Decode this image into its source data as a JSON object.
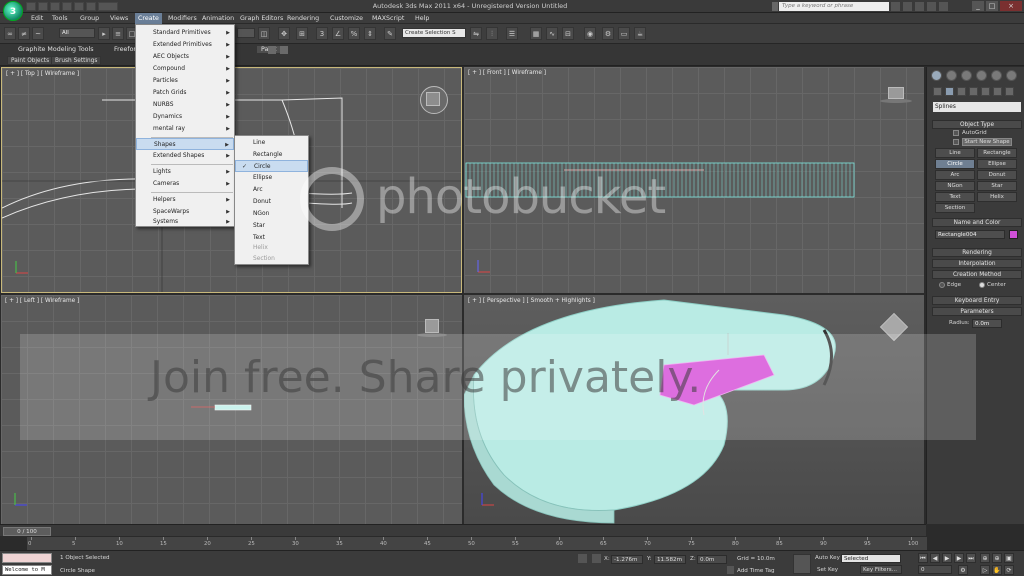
{
  "window": {
    "title": "Autodesk 3ds Max  2011 x64 - Unregistered Version   Untitled",
    "help_search_placeholder": "Type a keyword or phrase",
    "minimize": "_",
    "maximize": "□",
    "close": "×"
  },
  "menubar": [
    "Edit",
    "Tools",
    "Group",
    "Views",
    "Create",
    "Modifiers",
    "Animation",
    "Graph Editors",
    "Rendering",
    "Customize",
    "MAXScript",
    "Help"
  ],
  "toolbar": {
    "selection_filter": "All",
    "named_selection": "Create Selection S",
    "view_dropdown": ""
  },
  "ribbon": {
    "tabs": [
      "Graphite Modeling Tools",
      "Freeform",
      "Paint"
    ],
    "buttons": [
      "Paint Objects",
      "Brush Settings"
    ]
  },
  "create_menu": {
    "items": [
      "Standard Primitives",
      "Extended Primitives",
      "AEC Objects",
      "Compound",
      "Particles",
      "Patch Grids",
      "NURBS",
      "Dynamics",
      "mental ray",
      "Shapes",
      "Extended Shapes",
      "Lights",
      "Cameras",
      "Helpers",
      "SpaceWarps",
      "Systems"
    ],
    "highlighted": "Shapes",
    "arrow": "▶"
  },
  "shapes_menu": {
    "items": [
      "Line",
      "Rectangle",
      "Circle",
      "Ellipse",
      "Arc",
      "Donut",
      "NGon",
      "Star",
      "Text",
      "Helix",
      "Section"
    ],
    "checked": "Circle",
    "check_mark": "✓"
  },
  "viewports": {
    "top": "[ + ] [ Top ] [ Wireframe ]",
    "front": "[ + ] [ Front ] [ Wireframe ]",
    "left": "[ + ] [ Left ] [ Wireframe ]",
    "perspective": "[ + ] [ Perspective ] [ Smooth + Highlights ]"
  },
  "command_panel": {
    "category": "Splines",
    "object_type": "Object Type",
    "autogrid": "AutoGrid",
    "start_new_shape": "Start New Shape",
    "buttons": [
      "Line",
      "Rectangle",
      "Circle",
      "Ellipse",
      "Arc",
      "Donut",
      "NGon",
      "Star",
      "Text",
      "Helix",
      "Section"
    ],
    "selected_button": "Circle",
    "name_and_color": "Name and Color",
    "object_name": "Rectangle004",
    "object_color": "#d050d8",
    "rollouts": [
      "Rendering",
      "Interpolation",
      "Creation Method"
    ],
    "creation_options": [
      "Edge",
      "Center"
    ],
    "keyboard_entry": "Keyboard Entry",
    "parameters": "Parameters",
    "radius_label": "Radius:",
    "radius_value": "0.0m"
  },
  "timeline": {
    "frame_display": "0 / 100",
    "ticks": [
      "0",
      "5",
      "10",
      "15",
      "20",
      "25",
      "30",
      "35",
      "40",
      "45",
      "50",
      "55",
      "60",
      "65",
      "70",
      "75",
      "80",
      "85",
      "90",
      "95",
      "100"
    ]
  },
  "status": {
    "listener": "Welcome to M",
    "selection": "1 Object Selected",
    "prompt": "Circle Shape",
    "x_label": "X:",
    "x_value": "-1.276m",
    "y_label": "Y:",
    "y_value": "11.582m",
    "z_label": "Z:",
    "z_value": "0.0m",
    "grid": "Grid = 10.0m",
    "add_time_tag": "Add Time Tag",
    "auto_key": "Auto Key",
    "set_key": "Set Key",
    "key_mode": "Selected",
    "key_filters": "Key Filters...",
    "frame": "0"
  },
  "watermark": {
    "brand": "photobucket",
    "tagline": "Join free. Share privately."
  },
  "colors": {
    "viewport_bg": "#5b5b5b",
    "active_border": "#c8b87a",
    "model_cyan": "#b9ebe4",
    "model_magenta": "#d64fd8",
    "menu_highlight": "#c9dcf0"
  }
}
